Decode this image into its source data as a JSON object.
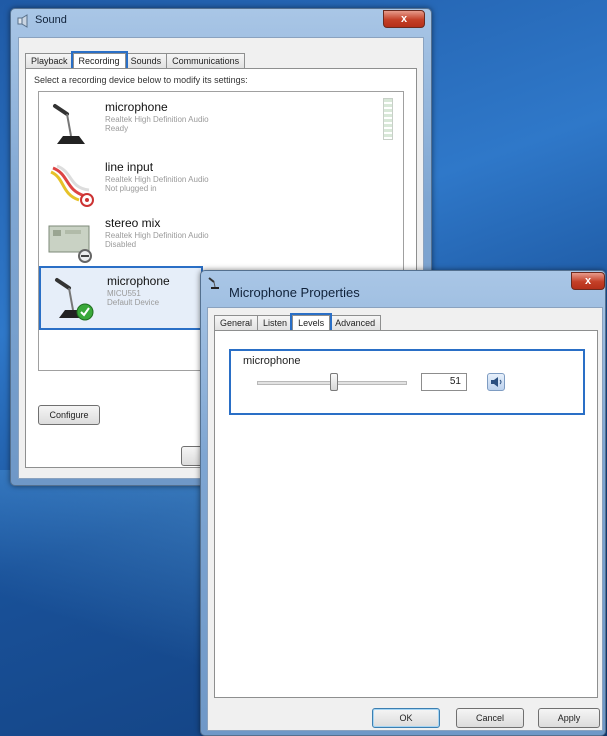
{
  "sound_window": {
    "title": "Sound",
    "close_label": "x",
    "tabs": [
      {
        "label": "Playback"
      },
      {
        "label": "Recording"
      },
      {
        "label": "Sounds"
      },
      {
        "label": "Communications"
      }
    ],
    "instruction": "Select a recording device below to modify its settings:",
    "devices": [
      {
        "name": "microphone",
        "line1": "Realtek High Definition Audio",
        "line2": "Ready",
        "icon": "microphone-icon"
      },
      {
        "name": "line input",
        "line1": "Realtek High Definition Audio",
        "line2": "Not plugged in",
        "icon": "line-input-cable-icon"
      },
      {
        "name": "stereo mix",
        "line1": "Realtek High Definition Audio",
        "line2": "Disabled",
        "icon": "sound-card-icon"
      },
      {
        "name": "microphone",
        "line1": "MICU551",
        "line2": "Default Device",
        "icon": "microphone-icon"
      }
    ],
    "configure_label": "Configure"
  },
  "props_window": {
    "title": "Microphone Properties",
    "close_label": "x",
    "tabs": [
      {
        "label": "General"
      },
      {
        "label": "Listen"
      },
      {
        "label": "Levels"
      },
      {
        "label": "Advanced"
      }
    ],
    "levels": {
      "group_label": "microphone",
      "value": "51",
      "slider_fraction": 0.51
    },
    "buttons": {
      "ok": "OK",
      "cancel": "Cancel",
      "apply": "Apply"
    }
  },
  "colors": {
    "highlight": "#2a6fc6",
    "desktop": "#1f5aa6"
  }
}
